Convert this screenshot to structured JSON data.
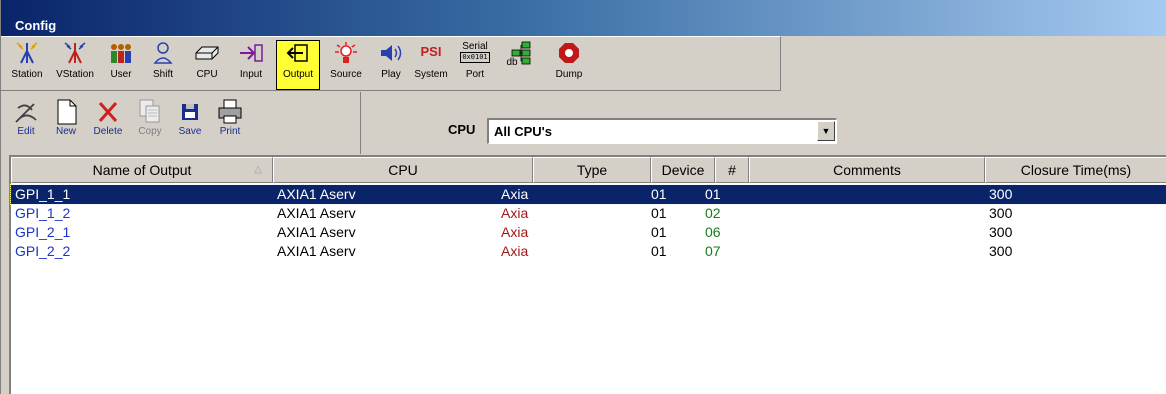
{
  "window": {
    "title": "Config"
  },
  "toolbar_main": {
    "items": [
      {
        "label": "Station",
        "icon": "station-icon"
      },
      {
        "label": "VStation",
        "icon": "vstation-icon"
      },
      {
        "label": "User",
        "icon": "users-icon"
      },
      {
        "label": "Shift",
        "icon": "shift-icon"
      },
      {
        "label": "CPU",
        "icon": "cpu-icon"
      },
      {
        "label": "Input",
        "icon": "input-icon"
      },
      {
        "label": "Output",
        "icon": "output-icon",
        "active": true
      },
      {
        "label": "Source",
        "icon": "source-icon"
      },
      {
        "label": "Play",
        "icon": "play-icon"
      },
      {
        "label": "System",
        "icon": "psi-system-icon",
        "icon_text": "PSI"
      },
      {
        "label": "Port",
        "icon": "serial-port-icon",
        "icon_text": "Serial",
        "icon_subtext": "0x0101"
      },
      {
        "label": "db",
        "icon": "database-icon"
      },
      {
        "label": "Dump",
        "icon": "dump-icon"
      }
    ]
  },
  "toolbar_edit": {
    "items": [
      {
        "label": "Edit",
        "icon": "edit-icon",
        "enabled": true
      },
      {
        "label": "New",
        "icon": "new-document-icon",
        "enabled": true
      },
      {
        "label": "Delete",
        "icon": "delete-icon",
        "enabled": true
      },
      {
        "label": "Copy",
        "icon": "copy-icon",
        "enabled": false
      },
      {
        "label": "Save",
        "icon": "save-icon",
        "enabled": true
      },
      {
        "label": "Print",
        "icon": "print-icon",
        "enabled": true
      }
    ]
  },
  "cpu_filter": {
    "label": "CPU",
    "value": "All CPU's",
    "dropdown_glyph": "▼"
  },
  "table": {
    "sort_arrow": "△",
    "columns": [
      "Name of Output",
      "CPU",
      "Type",
      "Device",
      "#",
      "Comments",
      "Closure Time(ms)"
    ],
    "rows": [
      {
        "name": "GPI_1_1",
        "cpu": "AXIA1 Aserv",
        "type": "Axia",
        "device": "01",
        "num": "01",
        "comments": "",
        "closure": "300",
        "selected": true
      },
      {
        "name": "GPI_1_2",
        "cpu": "AXIA1 Aserv",
        "type": "Axia",
        "device": "01",
        "num": "02",
        "comments": "",
        "closure": "300"
      },
      {
        "name": "GPI_2_1",
        "cpu": "AXIA1 Aserv",
        "type": "Axia",
        "device": "01",
        "num": "06",
        "comments": "",
        "closure": "300"
      },
      {
        "name": "GPI_2_2",
        "cpu": "AXIA1 Aserv",
        "type": "Axia",
        "device": "01",
        "num": "07",
        "comments": "",
        "closure": "300"
      }
    ]
  },
  "colors": {
    "title_bar_start": "#0a246a",
    "title_bar_end": "#a6caf0",
    "selection": "#0a246a",
    "active_tool": "#ffff33",
    "name_text": "#1a35c8",
    "type_text": "#a01818",
    "number_text": "#1a7a1a"
  }
}
